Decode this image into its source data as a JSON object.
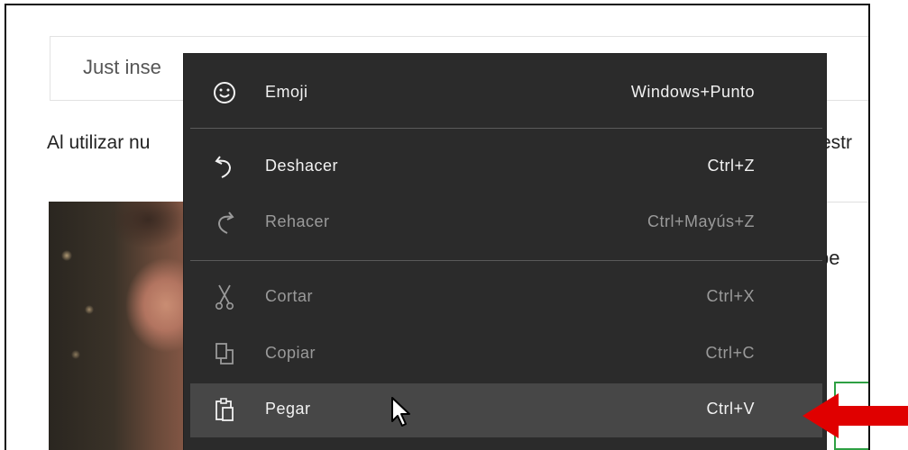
{
  "page": {
    "search_text": "Just inse",
    "notice_text": "Al utilizar nu",
    "notice_tail": "estr",
    "side_text": "be"
  },
  "menu": {
    "items": [
      {
        "icon": "emoji-icon",
        "label": "Emoji",
        "shortcut": "Windows+Punto",
        "enabled": true
      },
      {
        "icon": "undo-icon",
        "label": "Deshacer",
        "shortcut": "Ctrl+Z",
        "enabled": true
      },
      {
        "icon": "redo-icon",
        "label": "Rehacer",
        "shortcut": "Ctrl+Mayús+Z",
        "enabled": false
      },
      {
        "icon": "cut-icon",
        "label": "Cortar",
        "shortcut": "Ctrl+X",
        "enabled": false
      },
      {
        "icon": "copy-icon",
        "label": "Copiar",
        "shortcut": "Ctrl+C",
        "enabled": false
      },
      {
        "icon": "paste-icon",
        "label": "Pegar",
        "shortcut": "Ctrl+V",
        "enabled": true,
        "highlighted": true
      }
    ]
  },
  "colors": {
    "menu_bg": "#2b2b2b",
    "menu_hover": "#474747",
    "arrow": "#e00000",
    "accent_green": "#2ea043"
  }
}
